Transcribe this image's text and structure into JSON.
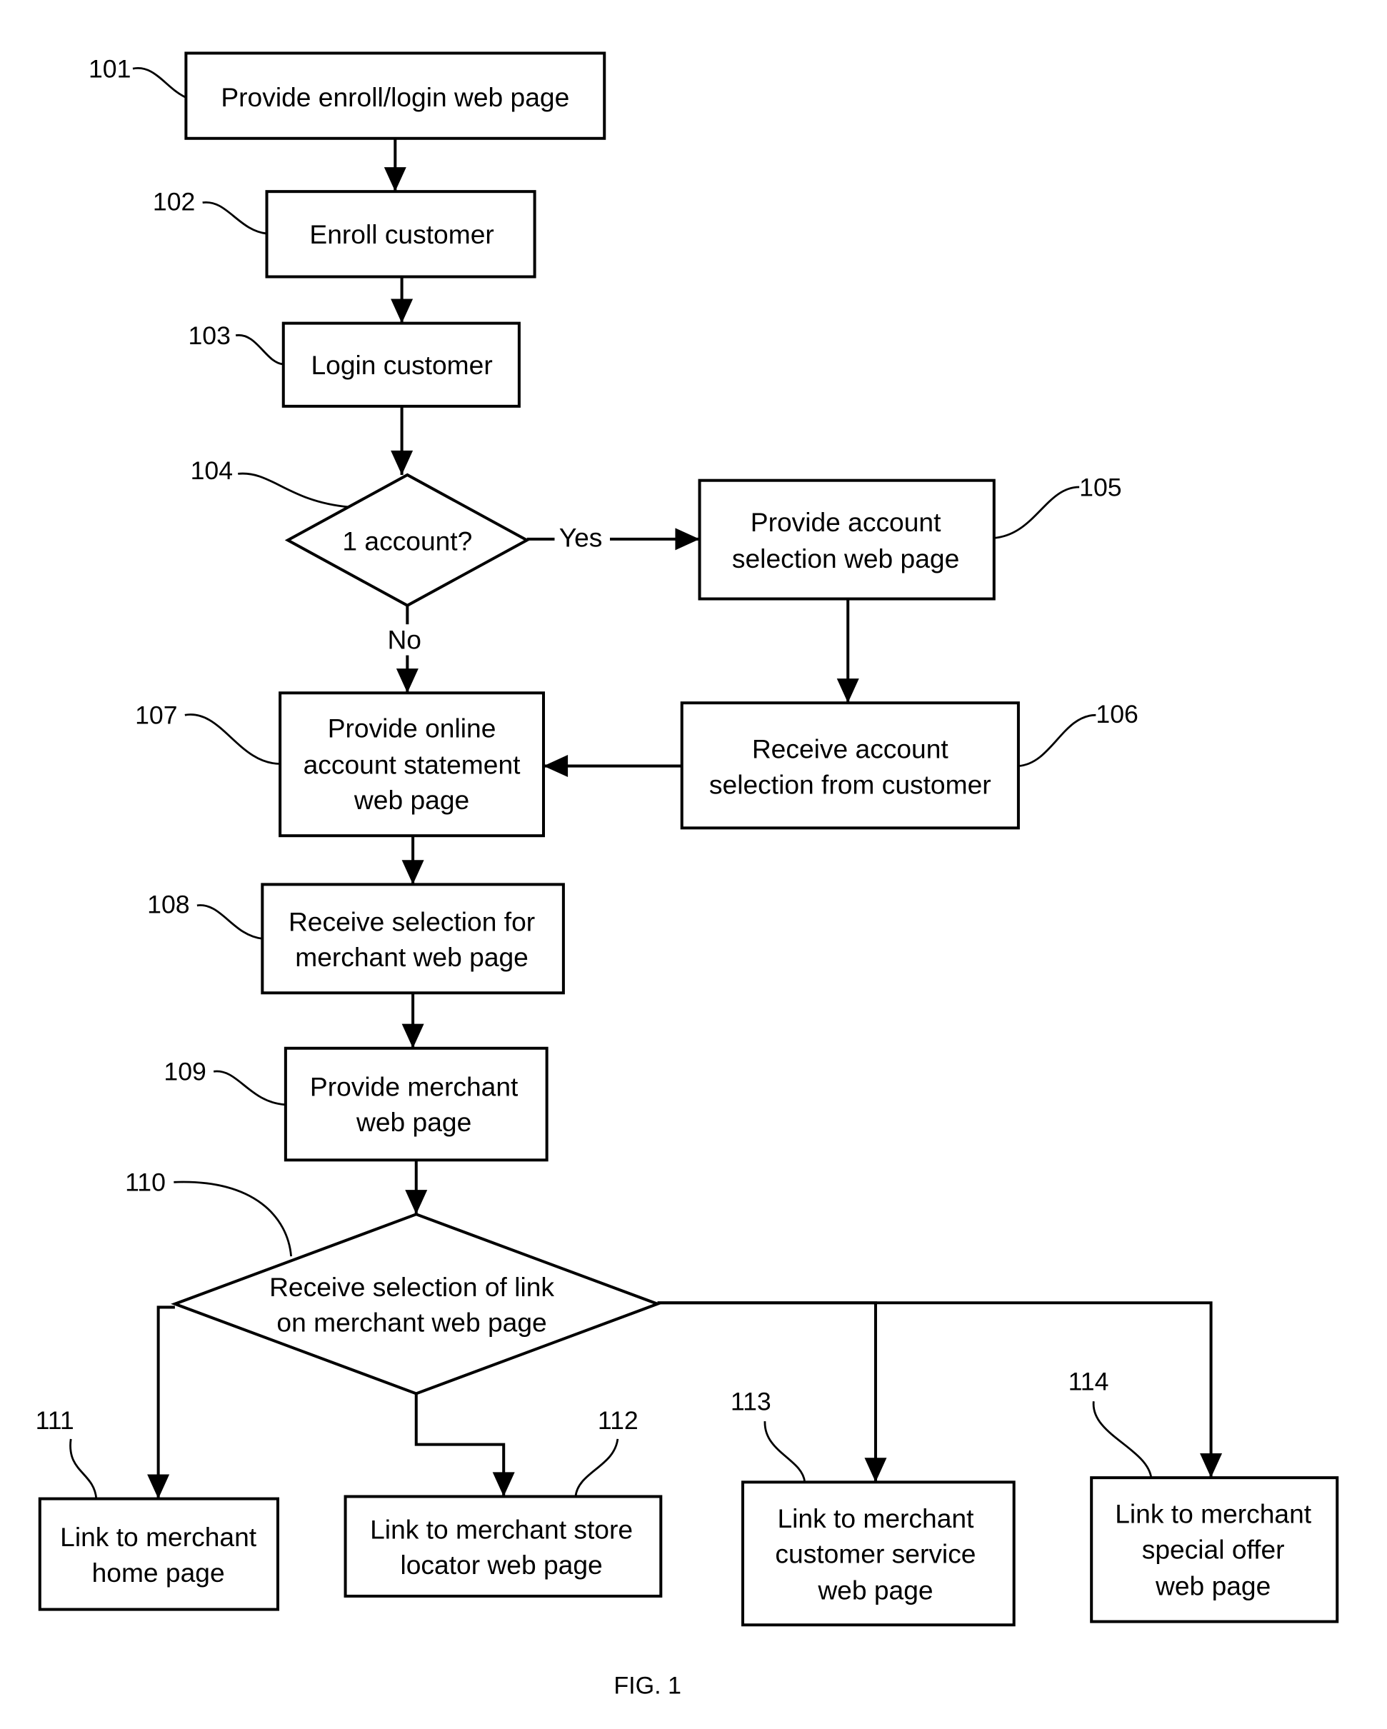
{
  "figure": {
    "caption": "FIG. 1",
    "nodes": [
      {
        "id": "101",
        "ref": "101",
        "shape": "box",
        "lines": [
          "Provide enroll/login web page"
        ]
      },
      {
        "id": "102",
        "ref": "102",
        "shape": "box",
        "lines": [
          "Enroll customer"
        ]
      },
      {
        "id": "103",
        "ref": "103",
        "shape": "box",
        "lines": [
          "Login customer"
        ]
      },
      {
        "id": "104",
        "ref": "104",
        "shape": "diamond",
        "lines": [
          "1 account?"
        ]
      },
      {
        "id": "105",
        "ref": "105",
        "shape": "box",
        "lines": [
          "Provide account",
          "selection web page"
        ]
      },
      {
        "id": "106",
        "ref": "106",
        "shape": "box",
        "lines": [
          "Receive account",
          "selection from customer"
        ]
      },
      {
        "id": "107",
        "ref": "107",
        "shape": "box",
        "lines": [
          "Provide online",
          "account statement",
          "web page"
        ]
      },
      {
        "id": "108",
        "ref": "108",
        "shape": "box",
        "lines": [
          "Receive selection for",
          "merchant web page"
        ]
      },
      {
        "id": "109",
        "ref": "109",
        "shape": "box",
        "lines": [
          "Provide merchant",
          "web page"
        ]
      },
      {
        "id": "110",
        "ref": "110",
        "shape": "diamond",
        "lines": [
          "Receive selection of link",
          "on merchant web page"
        ]
      },
      {
        "id": "111",
        "ref": "111",
        "shape": "box",
        "lines": [
          "Link to merchant",
          "home page"
        ]
      },
      {
        "id": "112",
        "ref": "112",
        "shape": "box",
        "lines": [
          "Link to merchant store",
          "locator web page"
        ]
      },
      {
        "id": "113",
        "ref": "113",
        "shape": "box",
        "lines": [
          "Link to merchant",
          "customer service",
          "web page"
        ]
      },
      {
        "id": "114",
        "ref": "114",
        "shape": "box",
        "lines": [
          "Link to merchant",
          "special offer",
          "web page"
        ]
      }
    ],
    "edges": [
      {
        "from": "101",
        "to": "102",
        "label": ""
      },
      {
        "from": "102",
        "to": "103",
        "label": ""
      },
      {
        "from": "103",
        "to": "104",
        "label": ""
      },
      {
        "from": "104",
        "to": "105",
        "label": "Yes"
      },
      {
        "from": "104",
        "to": "107",
        "label": "No"
      },
      {
        "from": "105",
        "to": "106",
        "label": ""
      },
      {
        "from": "106",
        "to": "107",
        "label": ""
      },
      {
        "from": "107",
        "to": "108",
        "label": ""
      },
      {
        "from": "108",
        "to": "109",
        "label": ""
      },
      {
        "from": "109",
        "to": "110",
        "label": ""
      },
      {
        "from": "110",
        "to": "111",
        "label": ""
      },
      {
        "from": "110",
        "to": "112",
        "label": ""
      },
      {
        "from": "110",
        "to": "113",
        "label": ""
      },
      {
        "from": "110",
        "to": "114",
        "label": ""
      }
    ]
  }
}
